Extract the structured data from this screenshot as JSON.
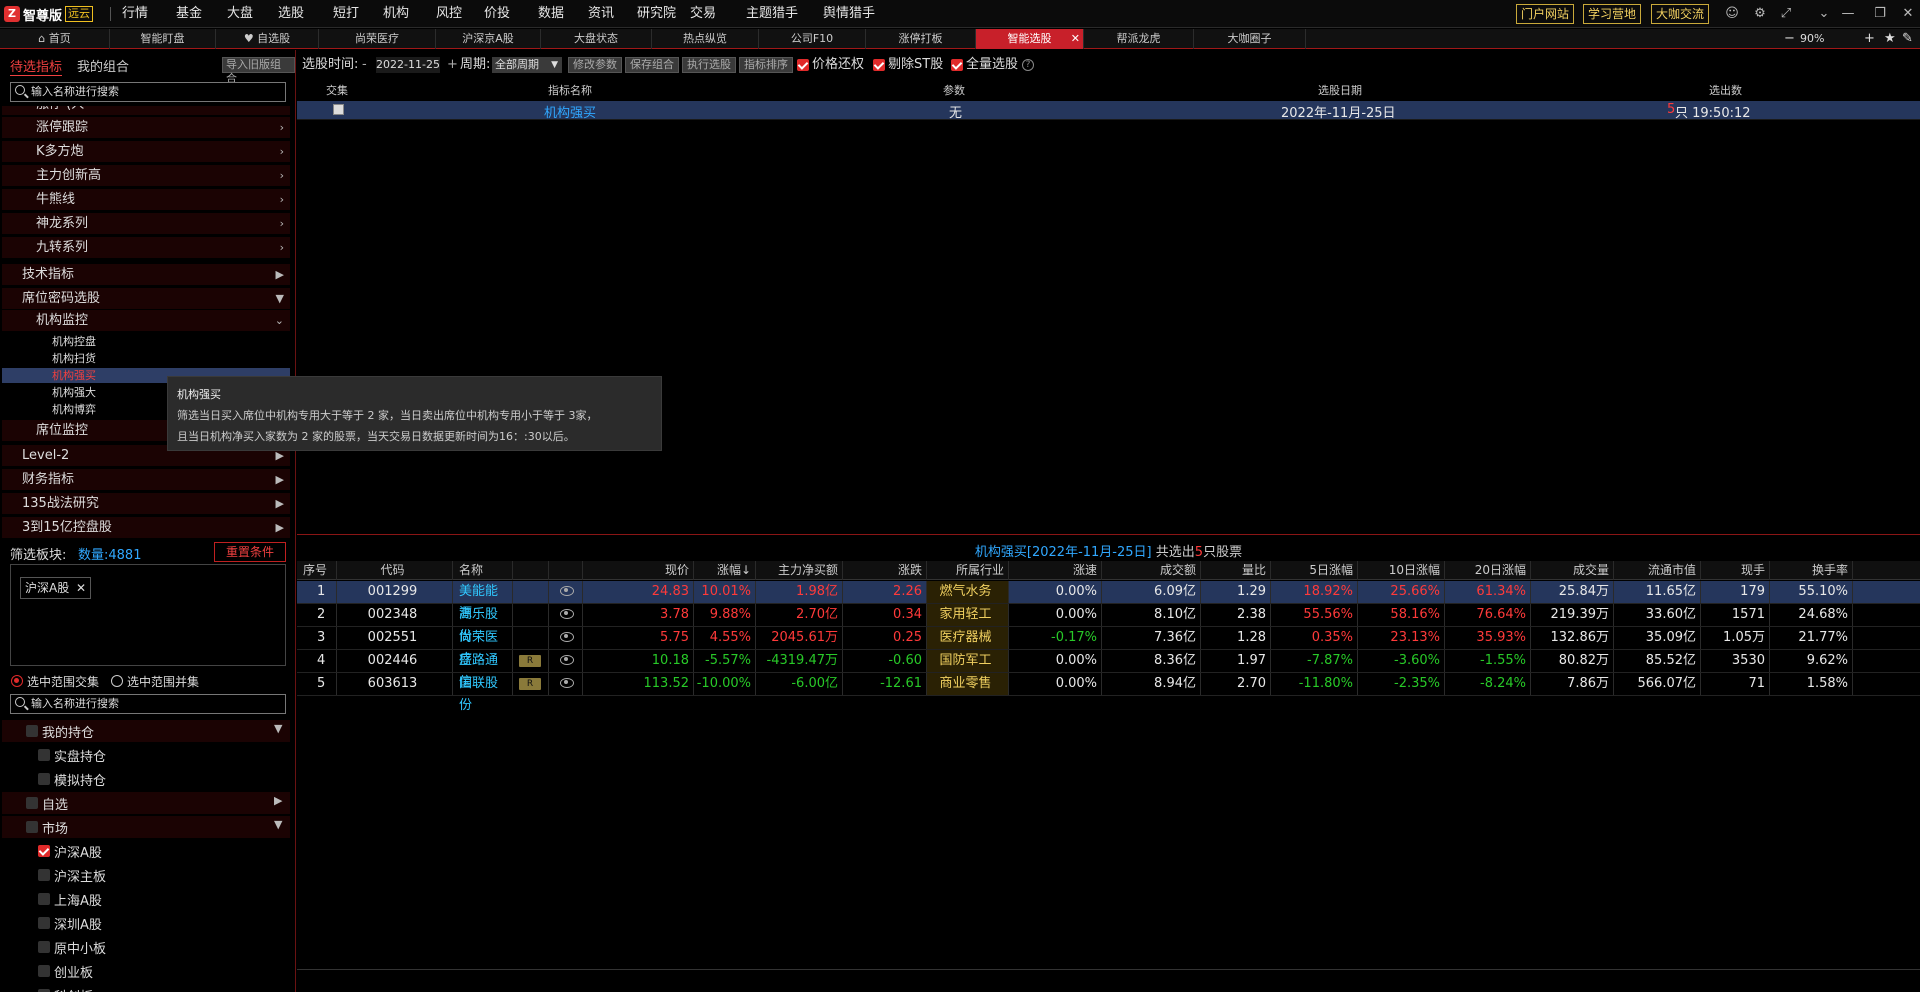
{
  "app": {
    "logo_mark": "Z",
    "name": "智尊版",
    "version_badge": "远云"
  },
  "menu": [
    {
      "label": "行情",
      "dot": false
    },
    {
      "label": "基金",
      "dot": true
    },
    {
      "label": "大盘",
      "dot": false
    },
    {
      "label": "选股",
      "dot": true
    },
    {
      "label": "短打",
      "dot": false
    },
    {
      "label": "机构",
      "dot": true
    },
    {
      "label": "风控",
      "dot": false
    },
    {
      "label": "价投",
      "dot": false
    },
    {
      "label": "数据",
      "dot": false
    },
    {
      "label": "资讯",
      "dot": false
    },
    {
      "label": "研究院",
      "dot": false
    },
    {
      "label": "交易",
      "dot": false
    },
    {
      "label": "主题猎手",
      "dot": false
    },
    {
      "label": "舆情猎手",
      "dot": true
    }
  ],
  "top_buttons": [
    "门户网站",
    "学习营地",
    "大咖交流"
  ],
  "tabs": [
    "首页",
    "智能盯盘",
    "自选股",
    "尚荣医疗",
    "沪深京A股",
    "大盘状态",
    "热点纵览",
    "公司F10",
    "涨停打板",
    "智能选股",
    "帮派龙虎",
    "大咖圈子"
  ],
  "active_tab": "智能选股",
  "zoom": "90%",
  "left": {
    "tab_pending": "待选指标",
    "tab_mine": "我的组合",
    "import_btn": "导入旧版组合",
    "search_placeholder": "输入名称进行搜索",
    "tree": [
      {
        "label": "涨停跟踪"
      },
      {
        "label": "K多方炮"
      },
      {
        "label": "主力创新高"
      },
      {
        "label": "牛熊线"
      },
      {
        "label": "神龙系列"
      },
      {
        "label": "九转系列"
      },
      {
        "label": "技术指标"
      },
      {
        "label": "席位密码选股"
      },
      {
        "label": "机构监控"
      },
      {
        "label": "机构控盘"
      },
      {
        "label": "机构扫货"
      },
      {
        "label": "机构强买"
      },
      {
        "label": "机构强大"
      },
      {
        "label": "机构博弈"
      },
      {
        "label": "席位监控"
      },
      {
        "label": "Level-2"
      },
      {
        "label": "财务指标"
      },
      {
        "label": "135战法研究"
      },
      {
        "label": "3到15亿控盘股"
      }
    ],
    "tree_partial": "涨停 (人",
    "filter_label": "筛选板块:",
    "filter_count": "数量:4881",
    "reset_btn": "重置条件",
    "selected_tag": "沪深A股",
    "radio_intersect": "选中范围交集",
    "radio_union": "选中范围并集",
    "search2_placeholder": "输入名称进行搜索",
    "checks": [
      {
        "label": "我的持仓",
        "on": false
      },
      {
        "label": "实盘持仓",
        "on": false
      },
      {
        "label": "模拟持仓",
        "on": false
      },
      {
        "label": "自选",
        "on": false
      },
      {
        "label": "市场",
        "on": false
      },
      {
        "label": "沪深A股",
        "on": true
      },
      {
        "label": "沪深主板",
        "on": false
      },
      {
        "label": "上海A股",
        "on": false
      },
      {
        "label": "深圳A股",
        "on": false
      },
      {
        "label": "原中小板",
        "on": false
      },
      {
        "label": "创业板",
        "on": false
      },
      {
        "label": "科创板",
        "on": false
      }
    ]
  },
  "tooltip": {
    "title": "机构强买",
    "line1": "筛选当日买入席位中机构专用大于等于 2 家，当日卖出席位中机构专用小于等于 3家，",
    "line2": "且当日机构净买入家数为 2 家的股票，当天交易日数据更新时间为16：:30以后。"
  },
  "toolbar": {
    "date_label": "选股时间:",
    "date_minus": "-",
    "date_value": "2022-11-25",
    "date_plus": "+",
    "period_label": "周期:",
    "period_value": "全部周期",
    "btn_modify": "修改参数",
    "btn_save": "保存组合",
    "btn_exec": "执行选股",
    "btn_sort": "指标排序",
    "chk_price": "价格还权",
    "chk_st": "剔除ST股",
    "chk_all": "全量选股",
    "help": "?"
  },
  "upper_table": {
    "headers": [
      "交集",
      "指标名称",
      "参数",
      "选股日期",
      "选出数"
    ],
    "row": {
      "name": "机构强买",
      "param": "无",
      "date": "2022年-11月-25日",
      "count": "5",
      "count_unit": "只 19:50:12"
    }
  },
  "lower_title": {
    "name": "机构强买[2022年-11月-25日]",
    "mid": "共选出",
    "count": "5",
    "tail": "只股票"
  },
  "lower_headers": [
    "序号",
    "代码",
    "名称",
    "",
    "",
    "现价",
    "涨幅↓",
    "主力净买额",
    "涨跌",
    "所属行业",
    "涨速",
    "成交额",
    "量比",
    "5日涨幅",
    "10日涨幅",
    "20日涨幅",
    "成交量",
    "流通市值",
    "现手",
    "换手率"
  ],
  "rows": [
    {
      "no": "1",
      "code": "001299",
      "name": "美能能源",
      "badge": "",
      "price": "24.83",
      "pct": "10.01%",
      "net": "1.98亿",
      "chg": "2.26",
      "ind": "燃气水务",
      "spd": "0.00%",
      "amt": "6.09亿",
      "vr": "1.29",
      "d5": "18.92%",
      "d10": "25.66%",
      "d20": "61.34%",
      "vol": "25.84万",
      "cap": "11.65亿",
      "hand": "179",
      "turn": "55.10%",
      "dir": "up",
      "d5dir": "up",
      "d10dir": "up",
      "d20dir": "up",
      "spddir": "flat"
    },
    {
      "no": "2",
      "code": "002348",
      "name": "高乐股份",
      "badge": "",
      "price": "3.78",
      "pct": "9.88%",
      "net": "2.70亿",
      "chg": "0.34",
      "ind": "家用轻工",
      "spd": "0.00%",
      "amt": "8.10亿",
      "vr": "2.38",
      "d5": "55.56%",
      "d10": "58.16%",
      "d20": "76.64%",
      "vol": "219.39万",
      "cap": "33.60亿",
      "hand": "1571",
      "turn": "24.68%",
      "dir": "up",
      "d5dir": "up",
      "d10dir": "up",
      "d20dir": "up",
      "spddir": "flat"
    },
    {
      "no": "3",
      "code": "002551",
      "name": "尚荣医疗",
      "badge": "",
      "price": "5.75",
      "pct": "4.55%",
      "net": "2045.61万",
      "chg": "0.25",
      "ind": "医疗器械",
      "spd": "-0.17%",
      "amt": "7.36亿",
      "vr": "1.28",
      "d5": "0.35%",
      "d10": "23.13%",
      "d20": "35.93%",
      "vol": "132.86万",
      "cap": "35.09亿",
      "hand": "1.05万",
      "turn": "21.77%",
      "dir": "up",
      "d5dir": "up",
      "d10dir": "up",
      "d20dir": "up",
      "spddir": "down"
    },
    {
      "no": "4",
      "code": "002446",
      "name": "盛路通信",
      "badge": "R",
      "price": "10.18",
      "pct": "-5.57%",
      "net": "-4319.47万",
      "chg": "-0.60",
      "ind": "国防军工",
      "spd": "0.00%",
      "amt": "8.36亿",
      "vr": "1.97",
      "d5": "-7.87%",
      "d10": "-3.60%",
      "d20": "-1.55%",
      "vol": "80.82万",
      "cap": "85.52亿",
      "hand": "3530",
      "turn": "9.62%",
      "dir": "down",
      "d5dir": "down",
      "d10dir": "down",
      "d20dir": "down",
      "spddir": "flat"
    },
    {
      "no": "5",
      "code": "603613",
      "name": "国联股份",
      "badge": "R",
      "price": "113.52",
      "pct": "-10.00%",
      "net": "-6.00亿",
      "chg": "-12.61",
      "ind": "商业零售",
      "spd": "0.00%",
      "amt": "8.94亿",
      "vr": "2.70",
      "d5": "-11.80%",
      "d10": "-2.35%",
      "d20": "-8.24%",
      "vol": "7.86万",
      "cap": "566.07亿",
      "hand": "71",
      "turn": "1.58%",
      "dir": "down",
      "d5dir": "down",
      "d10dir": "down",
      "d20dir": "down",
      "spddir": "flat"
    }
  ],
  "colors": {
    "up": "#ff3a3a",
    "down": "#28c928",
    "accent": "#c8202a",
    "name": "#30c8ff",
    "industry": "#f0d060"
  }
}
